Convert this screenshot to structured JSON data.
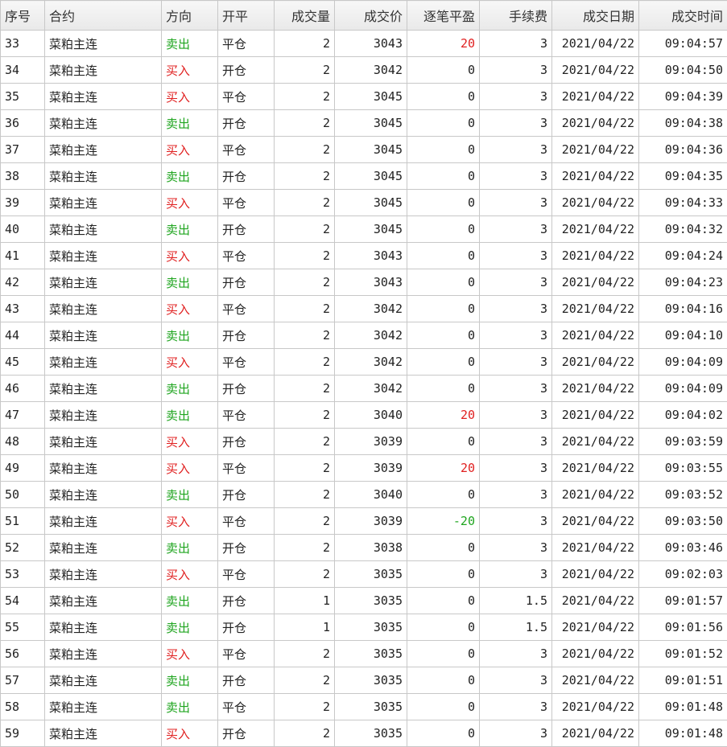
{
  "colors": {
    "sell": "#1fa51f",
    "buy": "#e02020",
    "profit": "#e02020",
    "loss": "#1fa51f",
    "text": "#222222"
  },
  "headers": [
    "序号",
    "合约",
    "方向",
    "开平",
    "成交量",
    "成交价",
    "逐笔平盈",
    "手续费",
    "成交日期",
    "成交时间"
  ],
  "rows": [
    {
      "seq": "33",
      "contract": "菜粕主连",
      "direction": "卖出",
      "offset": "平仓",
      "volume": "2",
      "price": "3043",
      "pnl": "20",
      "fee": "3",
      "date": "2021/04/22",
      "time": "09:04:57"
    },
    {
      "seq": "34",
      "contract": "菜粕主连",
      "direction": "买入",
      "offset": "开仓",
      "volume": "2",
      "price": "3042",
      "pnl": "0",
      "fee": "3",
      "date": "2021/04/22",
      "time": "09:04:50"
    },
    {
      "seq": "35",
      "contract": "菜粕主连",
      "direction": "买入",
      "offset": "平仓",
      "volume": "2",
      "price": "3045",
      "pnl": "0",
      "fee": "3",
      "date": "2021/04/22",
      "time": "09:04:39"
    },
    {
      "seq": "36",
      "contract": "菜粕主连",
      "direction": "卖出",
      "offset": "开仓",
      "volume": "2",
      "price": "3045",
      "pnl": "0",
      "fee": "3",
      "date": "2021/04/22",
      "time": "09:04:38"
    },
    {
      "seq": "37",
      "contract": "菜粕主连",
      "direction": "买入",
      "offset": "平仓",
      "volume": "2",
      "price": "3045",
      "pnl": "0",
      "fee": "3",
      "date": "2021/04/22",
      "time": "09:04:36"
    },
    {
      "seq": "38",
      "contract": "菜粕主连",
      "direction": "卖出",
      "offset": "开仓",
      "volume": "2",
      "price": "3045",
      "pnl": "0",
      "fee": "3",
      "date": "2021/04/22",
      "time": "09:04:35"
    },
    {
      "seq": "39",
      "contract": "菜粕主连",
      "direction": "买入",
      "offset": "平仓",
      "volume": "2",
      "price": "3045",
      "pnl": "0",
      "fee": "3",
      "date": "2021/04/22",
      "time": "09:04:33"
    },
    {
      "seq": "40",
      "contract": "菜粕主连",
      "direction": "卖出",
      "offset": "开仓",
      "volume": "2",
      "price": "3045",
      "pnl": "0",
      "fee": "3",
      "date": "2021/04/22",
      "time": "09:04:32"
    },
    {
      "seq": "41",
      "contract": "菜粕主连",
      "direction": "买入",
      "offset": "平仓",
      "volume": "2",
      "price": "3043",
      "pnl": "0",
      "fee": "3",
      "date": "2021/04/22",
      "time": "09:04:24"
    },
    {
      "seq": "42",
      "contract": "菜粕主连",
      "direction": "卖出",
      "offset": "开仓",
      "volume": "2",
      "price": "3043",
      "pnl": "0",
      "fee": "3",
      "date": "2021/04/22",
      "time": "09:04:23"
    },
    {
      "seq": "43",
      "contract": "菜粕主连",
      "direction": "买入",
      "offset": "平仓",
      "volume": "2",
      "price": "3042",
      "pnl": "0",
      "fee": "3",
      "date": "2021/04/22",
      "time": "09:04:16"
    },
    {
      "seq": "44",
      "contract": "菜粕主连",
      "direction": "卖出",
      "offset": "开仓",
      "volume": "2",
      "price": "3042",
      "pnl": "0",
      "fee": "3",
      "date": "2021/04/22",
      "time": "09:04:10"
    },
    {
      "seq": "45",
      "contract": "菜粕主连",
      "direction": "买入",
      "offset": "平仓",
      "volume": "2",
      "price": "3042",
      "pnl": "0",
      "fee": "3",
      "date": "2021/04/22",
      "time": "09:04:09"
    },
    {
      "seq": "46",
      "contract": "菜粕主连",
      "direction": "卖出",
      "offset": "开仓",
      "volume": "2",
      "price": "3042",
      "pnl": "0",
      "fee": "3",
      "date": "2021/04/22",
      "time": "09:04:09"
    },
    {
      "seq": "47",
      "contract": "菜粕主连",
      "direction": "卖出",
      "offset": "平仓",
      "volume": "2",
      "price": "3040",
      "pnl": "20",
      "fee": "3",
      "date": "2021/04/22",
      "time": "09:04:02"
    },
    {
      "seq": "48",
      "contract": "菜粕主连",
      "direction": "买入",
      "offset": "开仓",
      "volume": "2",
      "price": "3039",
      "pnl": "0",
      "fee": "3",
      "date": "2021/04/22",
      "time": "09:03:59"
    },
    {
      "seq": "49",
      "contract": "菜粕主连",
      "direction": "买入",
      "offset": "平仓",
      "volume": "2",
      "price": "3039",
      "pnl": "20",
      "fee": "3",
      "date": "2021/04/22",
      "time": "09:03:55"
    },
    {
      "seq": "50",
      "contract": "菜粕主连",
      "direction": "卖出",
      "offset": "开仓",
      "volume": "2",
      "price": "3040",
      "pnl": "0",
      "fee": "3",
      "date": "2021/04/22",
      "time": "09:03:52"
    },
    {
      "seq": "51",
      "contract": "菜粕主连",
      "direction": "买入",
      "offset": "平仓",
      "volume": "2",
      "price": "3039",
      "pnl": "-20",
      "fee": "3",
      "date": "2021/04/22",
      "time": "09:03:50"
    },
    {
      "seq": "52",
      "contract": "菜粕主连",
      "direction": "卖出",
      "offset": "开仓",
      "volume": "2",
      "price": "3038",
      "pnl": "0",
      "fee": "3",
      "date": "2021/04/22",
      "time": "09:03:46"
    },
    {
      "seq": "53",
      "contract": "菜粕主连",
      "direction": "买入",
      "offset": "平仓",
      "volume": "2",
      "price": "3035",
      "pnl": "0",
      "fee": "3",
      "date": "2021/04/22",
      "time": "09:02:03"
    },
    {
      "seq": "54",
      "contract": "菜粕主连",
      "direction": "卖出",
      "offset": "开仓",
      "volume": "1",
      "price": "3035",
      "pnl": "0",
      "fee": "1.5",
      "date": "2021/04/22",
      "time": "09:01:57"
    },
    {
      "seq": "55",
      "contract": "菜粕主连",
      "direction": "卖出",
      "offset": "开仓",
      "volume": "1",
      "price": "3035",
      "pnl": "0",
      "fee": "1.5",
      "date": "2021/04/22",
      "time": "09:01:56"
    },
    {
      "seq": "56",
      "contract": "菜粕主连",
      "direction": "买入",
      "offset": "平仓",
      "volume": "2",
      "price": "3035",
      "pnl": "0",
      "fee": "3",
      "date": "2021/04/22",
      "time": "09:01:52"
    },
    {
      "seq": "57",
      "contract": "菜粕主连",
      "direction": "卖出",
      "offset": "开仓",
      "volume": "2",
      "price": "3035",
      "pnl": "0",
      "fee": "3",
      "date": "2021/04/22",
      "time": "09:01:51"
    },
    {
      "seq": "58",
      "contract": "菜粕主连",
      "direction": "卖出",
      "offset": "平仓",
      "volume": "2",
      "price": "3035",
      "pnl": "0",
      "fee": "3",
      "date": "2021/04/22",
      "time": "09:01:48"
    },
    {
      "seq": "59",
      "contract": "菜粕主连",
      "direction": "买入",
      "offset": "开仓",
      "volume": "2",
      "price": "3035",
      "pnl": "0",
      "fee": "3",
      "date": "2021/04/22",
      "time": "09:01:48"
    }
  ]
}
